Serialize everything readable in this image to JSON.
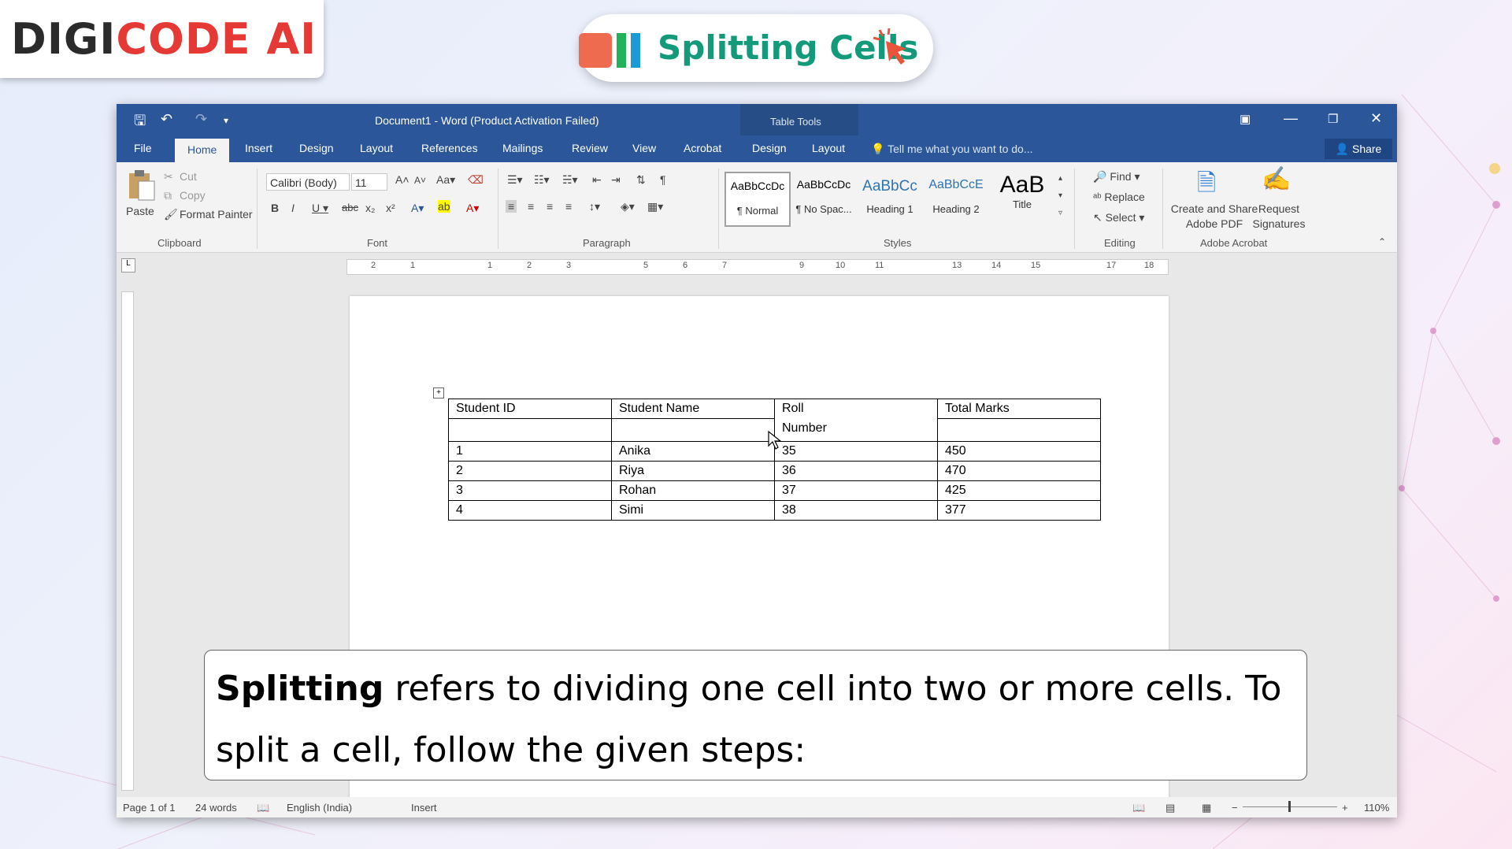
{
  "logo": {
    "part1": "DIGI",
    "part2": "CODE AI"
  },
  "header": {
    "title": "Splitting Cells"
  },
  "window": {
    "title": "Document1 - Word (Product Activation Failed)",
    "contextual_group": "Table Tools",
    "tabs": [
      "File",
      "Home",
      "Insert",
      "Design",
      "Layout",
      "References",
      "Mailings",
      "Review",
      "View",
      "Acrobat",
      "Design",
      "Layout"
    ],
    "active_tab": "Home",
    "tell_me": "Tell me what you want to do...",
    "share": "Share"
  },
  "ribbon": {
    "clipboard": {
      "paste": "Paste",
      "cut": "Cut",
      "copy": "Copy",
      "format_painter": "Format Painter",
      "label": "Clipboard"
    },
    "font": {
      "name": "Calibri (Body)",
      "size": "11",
      "label": "Font"
    },
    "paragraph": {
      "label": "Paragraph"
    },
    "styles": {
      "items": [
        {
          "preview": "AaBbCcDc",
          "name": "¶ Normal"
        },
        {
          "preview": "AaBbCcDc",
          "name": "¶ No Spac..."
        },
        {
          "preview": "AaBbCc",
          "name": "Heading 1"
        },
        {
          "preview": "AaBbCcE",
          "name": "Heading 2"
        },
        {
          "preview": "AaB",
          "name": "Title"
        }
      ],
      "label": "Styles"
    },
    "editing": {
      "find": "Find",
      "replace": "Replace",
      "select": "Select",
      "label": "Editing"
    },
    "acrobat": {
      "create_line1": "Create and Share",
      "create_line2": "Adobe PDF",
      "request_line1": "Request",
      "request_line2": "Signatures",
      "label": "Adobe Acrobat"
    }
  },
  "table": {
    "header": [
      "Student ID",
      "Student Name",
      "Roll",
      "Total Marks"
    ],
    "header_cont": [
      "",
      "",
      "Number",
      ""
    ],
    "rows": [
      [
        "1",
        "Anika",
        "35",
        "450"
      ],
      [
        "2",
        "Riya",
        "36",
        "470"
      ],
      [
        "3",
        "Rohan",
        "37",
        "425"
      ],
      [
        "4",
        "Simi",
        "38",
        "377"
      ]
    ]
  },
  "status": {
    "page": "Page 1 of 1",
    "words": "24 words",
    "language": "English (India)",
    "mode": "Insert",
    "zoom": "110%"
  },
  "caption": {
    "bold": "Splitting",
    "text": " refers to dividing one cell into two or more cells. To split a cell, follow the given steps:"
  }
}
